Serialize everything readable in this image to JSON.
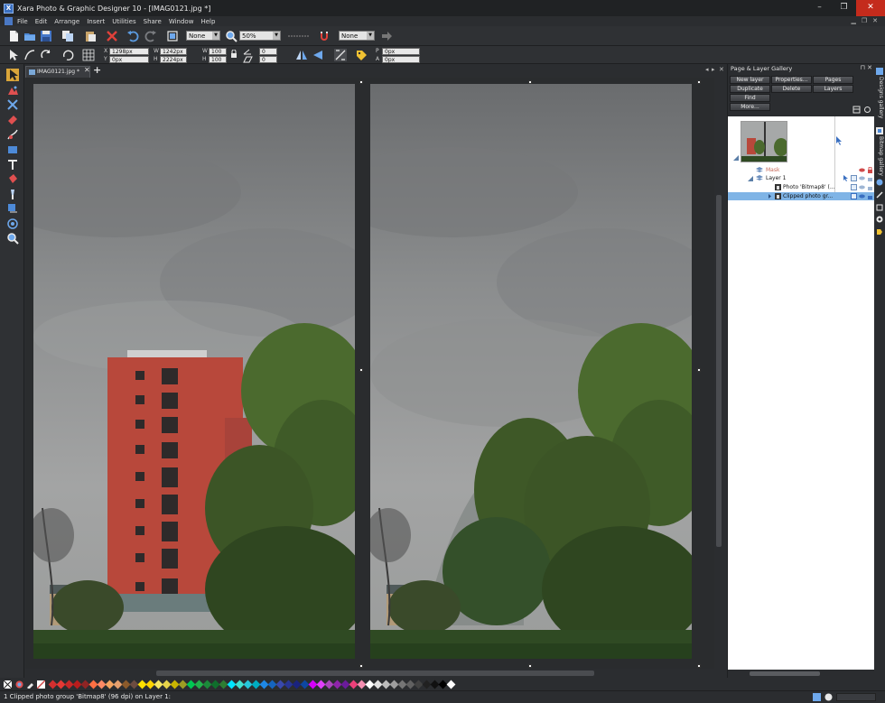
{
  "window": {
    "title": "Xara Photo & Graphic Designer 10 - [IMAG0121.jpg *]",
    "app_icon_letter": "X",
    "minimize": "–",
    "maximize": "❐",
    "close": "✕"
  },
  "menu": {
    "items": [
      "File",
      "Edit",
      "Arrange",
      "Insert",
      "Utilities",
      "Share",
      "Window",
      "Help"
    ]
  },
  "toolbar": {
    "quality_combo": "None",
    "zoom_combo": "50%",
    "feather_combo": "None",
    "x_label": "X",
    "x_value": "1298px",
    "y_label": "Y",
    "y_value": "0px",
    "w_label": "W",
    "w_value": "1242px",
    "h_label": "H",
    "h_value": "2224px",
    "scale_w_label": "W",
    "scale_w_value": "100",
    "scale_h_label": "H",
    "scale_h_value": "100",
    "rotate_value": "0",
    "skew_value": "0",
    "p_label": "P",
    "p_value": "0px",
    "a_label": "A",
    "a_value": "0px"
  },
  "document": {
    "tab_label": "IMAG0121.jpg *",
    "tab_close": "✕",
    "tab_add": "+"
  },
  "gallery": {
    "title": "Page & Layer Gallery",
    "buttons": {
      "new_layer": "New layer",
      "properties": "Properties...",
      "pages": "Pages",
      "duplicate": "Duplicate",
      "delete": "Delete",
      "layers": "Layers",
      "find": "Find",
      "more": "More..."
    },
    "rows": {
      "mask": "Mask",
      "layer1": "Layer 1",
      "photo": "Photo 'Bitmap8' (...",
      "clipped": "Clipped photo gr..."
    }
  },
  "side_tabs": {
    "designs": "Designs gallery",
    "bitmap": "Bitmap gallery"
  },
  "status": {
    "text": "1 Clipped photo group 'Bitmap8' (96 dpi) on Layer 1:"
  },
  "colors": {
    "accent": "#3a6fc0",
    "selection": "#7fb4e6",
    "building": "#b8483b",
    "mask_text": "#c86a5a",
    "palette": [
      "#d32f2f",
      "#e53935",
      "#c62828",
      "#b71c1c",
      "#8e2424",
      "#ff7043",
      "#ff8a65",
      "#f4a460",
      "#e6a06e",
      "#8b5a2b",
      "#6d4c41",
      "#ffe000",
      "#ffd400",
      "#f5e663",
      "#e6d34a",
      "#c8b400",
      "#9e9d24",
      "#00c853",
      "#22b14c",
      "#1b8a3a",
      "#0f6e2c",
      "#2e7d32",
      "#00e5ff",
      "#40e0d0",
      "#26c6da",
      "#00acc1",
      "#1e88e5",
      "#1565c0",
      "#3949ab",
      "#283593",
      "#1a237e",
      "#0d47a1",
      "#d500f9",
      "#e040fb",
      "#ab47bc",
      "#8e24aa",
      "#6a1b9a",
      "#ec407a",
      "#f48fb1",
      "#ffffff",
      "#e0e0e0",
      "#bdbdbd",
      "#9e9e9e",
      "#757575",
      "#616161",
      "#424242",
      "#212121",
      "#111111",
      "#000000",
      "#ffffff"
    ]
  }
}
